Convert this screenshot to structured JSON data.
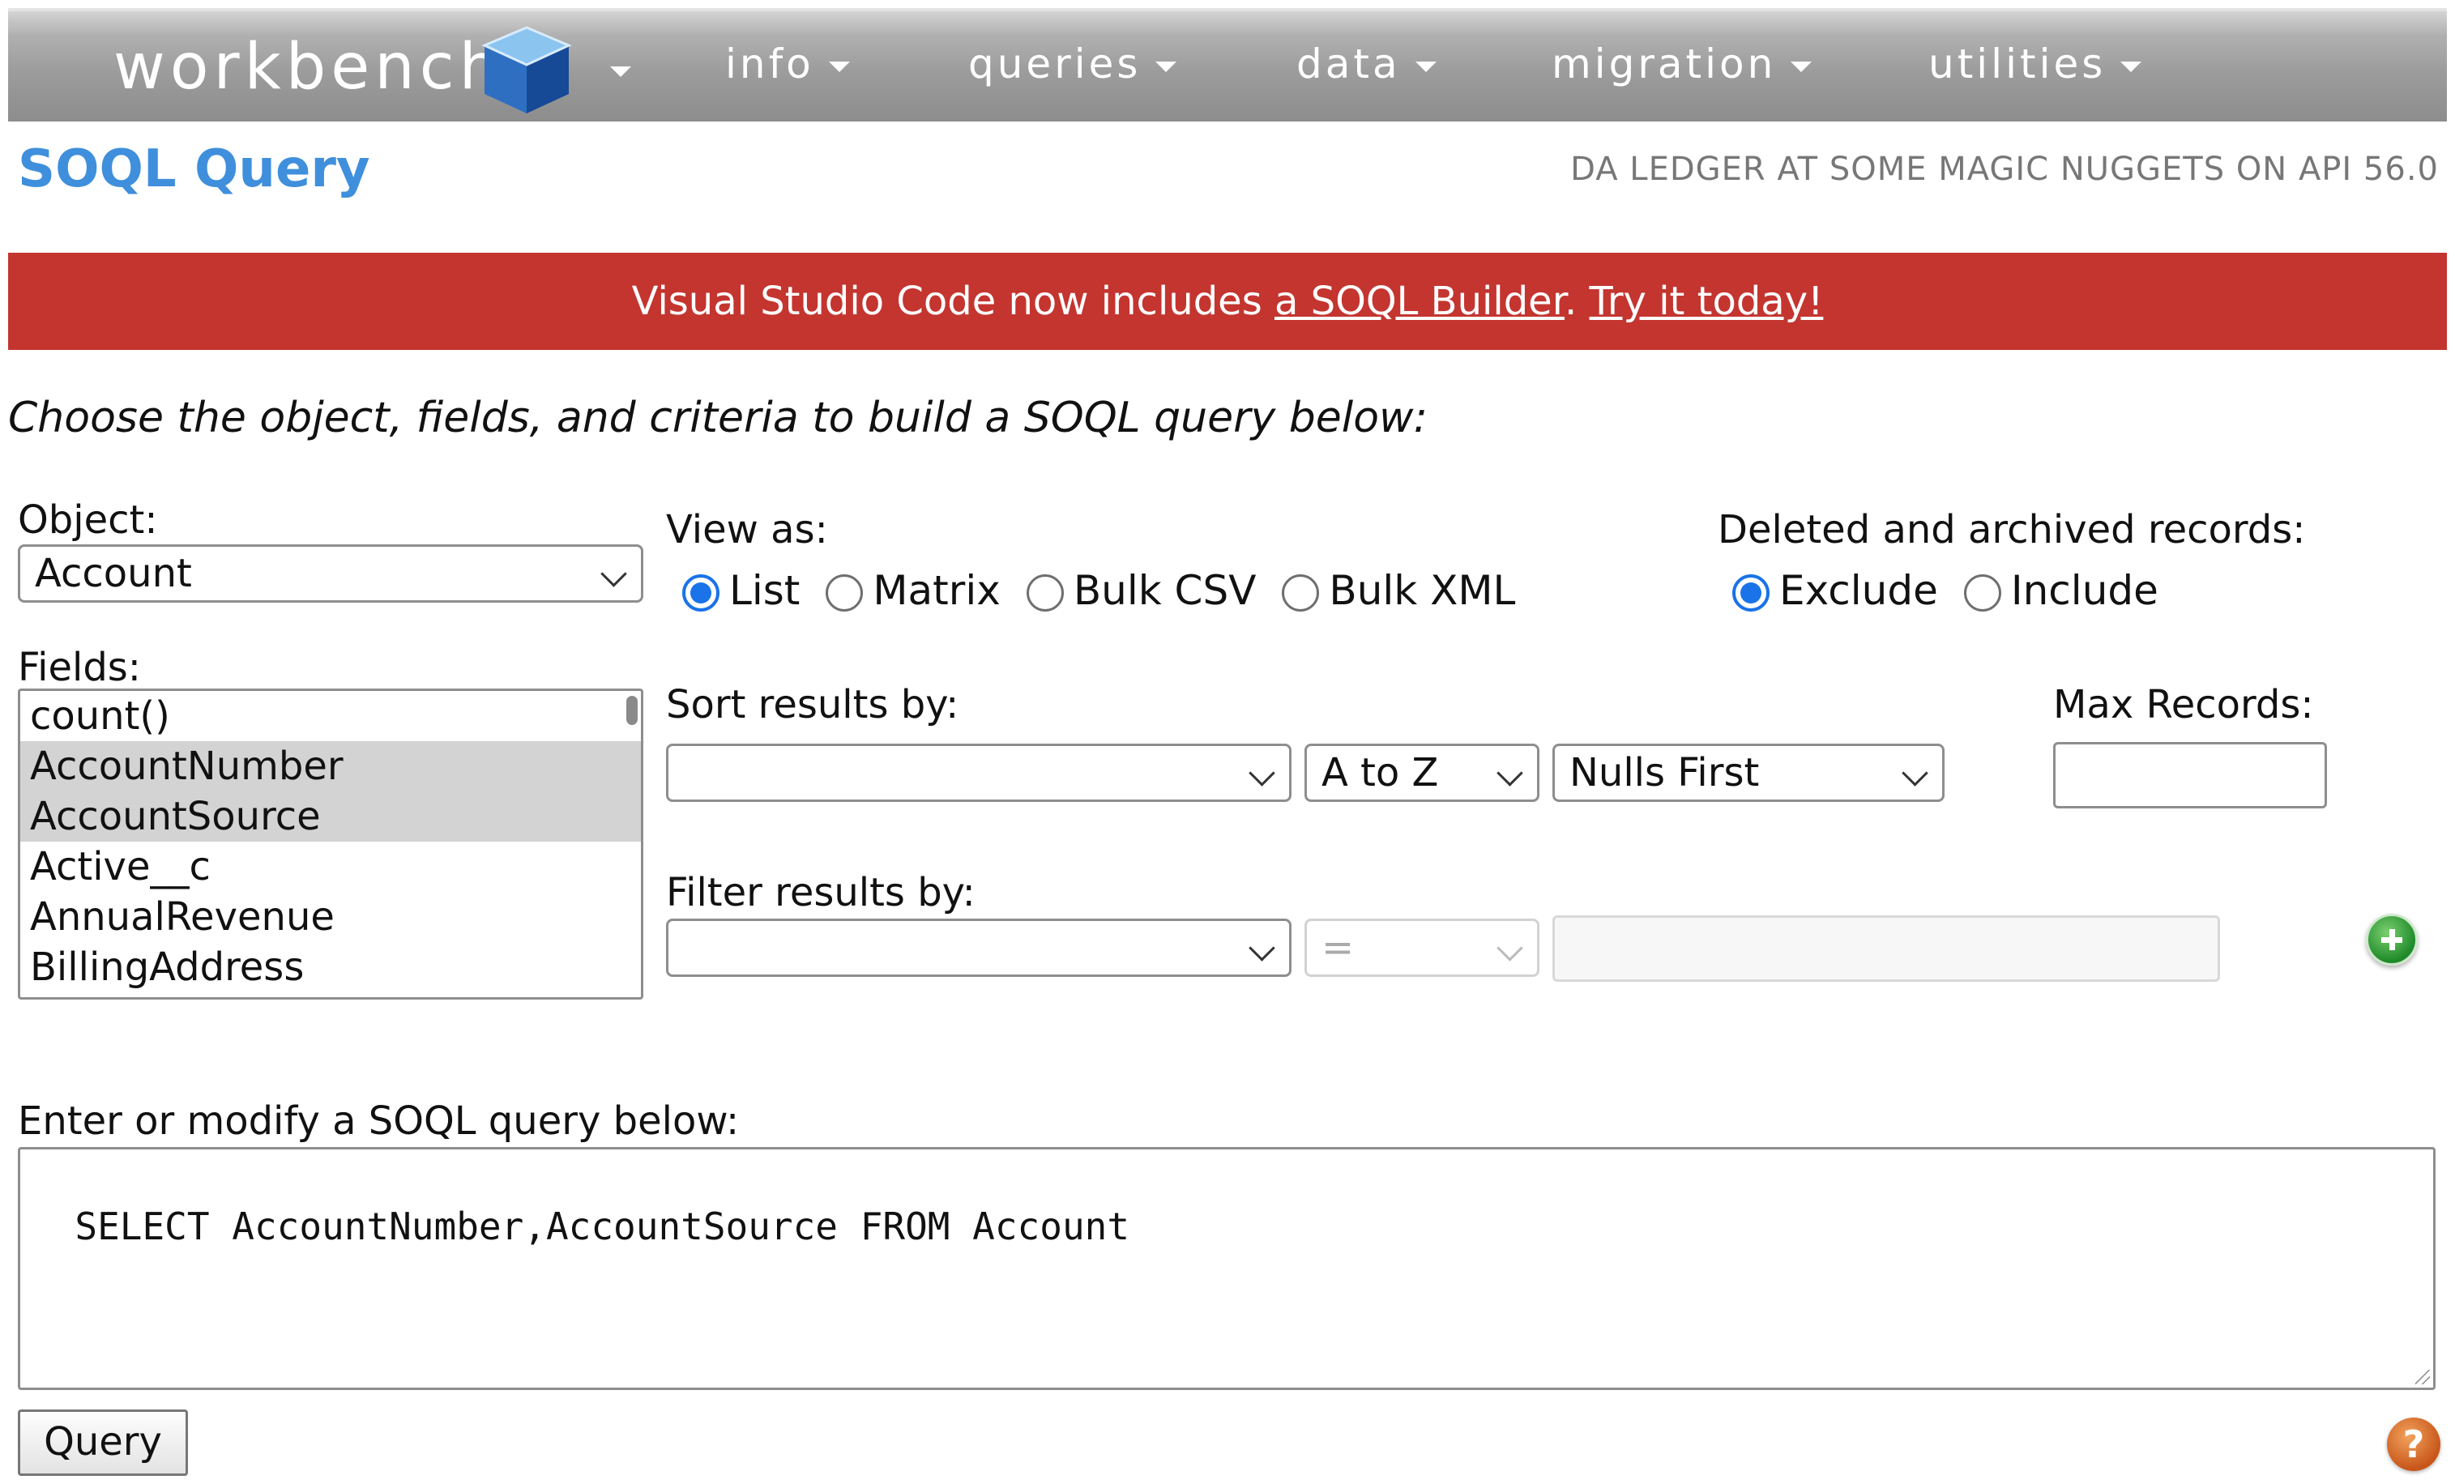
{
  "nav": {
    "logo": "workbench",
    "items": [
      {
        "label": "info"
      },
      {
        "label": "queries"
      },
      {
        "label": "data"
      },
      {
        "label": "migration"
      },
      {
        "label": "utilities"
      }
    ]
  },
  "header": {
    "title": "SOQL Query",
    "user_info": "DA LEDGER AT SOME MAGIC NUGGETS ON API 56.0"
  },
  "banner": {
    "prefix": "Visual Studio Code now includes ",
    "link1": "a SOQL Builder",
    "middle": ". ",
    "link2": "Try it today!"
  },
  "instructions": "Choose the object, fields, and criteria to build a SOQL query below:",
  "object": {
    "label": "Object:",
    "value": "Account"
  },
  "view_as": {
    "label": "View as:",
    "options": [
      "List",
      "Matrix",
      "Bulk CSV",
      "Bulk XML"
    ],
    "selected": "List"
  },
  "deleted": {
    "label": "Deleted and archived records:",
    "options": [
      "Exclude",
      "Include"
    ],
    "selected": "Exclude"
  },
  "fields": {
    "label": "Fields:",
    "items": [
      "count()",
      "AccountNumber",
      "AccountSource",
      "Active__c",
      "AnnualRevenue",
      "BillingAddress"
    ],
    "selected": [
      "AccountNumber",
      "AccountSource"
    ]
  },
  "sort": {
    "label": "Sort results by:",
    "field_value": "",
    "direction": "A to Z",
    "nulls": "Nulls First"
  },
  "max_records": {
    "label": "Max Records:",
    "value": ""
  },
  "filter": {
    "label": "Filter results by:",
    "field_value": "",
    "operator": "=",
    "value": ""
  },
  "query_box": {
    "label": "Enter or modify a SOQL query below:",
    "text": "SELECT AccountNumber,AccountSource FROM Account"
  },
  "query_button": "Query",
  "help_icon": "?",
  "colors": {
    "accent": "#3f8fdc",
    "banner": "#c43530",
    "radio": "#1a73e8"
  }
}
